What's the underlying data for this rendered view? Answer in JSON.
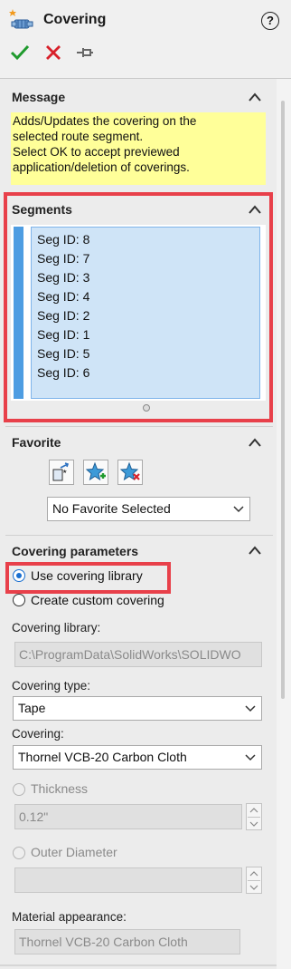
{
  "header": {
    "title": "Covering",
    "help_label": "?"
  },
  "actions": [
    "ok-checkmark",
    "cancel-x",
    "pushpin"
  ],
  "message": {
    "title": "Message",
    "lines": [
      "Adds/Updates the covering on the",
      "selected route segment.",
      "Select OK to accept previewed",
      "application/deletion of coverings."
    ]
  },
  "segments": {
    "title": "Segments",
    "items": [
      "Seg ID: 8",
      "Seg ID: 7",
      "Seg ID: 3",
      "Seg ID: 4",
      "Seg ID: 2",
      "Seg ID: 1",
      "Seg ID: 5",
      "Seg ID: 6"
    ]
  },
  "favorite": {
    "title": "Favorite",
    "selected": "No Favorite Selected"
  },
  "covering_parameters": {
    "title": "Covering parameters",
    "option_library": "Use covering library",
    "option_custom": "Create custom covering",
    "library_label": "Covering library:",
    "library_path": "C:\\ProgramData\\SolidWorks\\SOLIDWO",
    "type_label": "Covering type:",
    "type_value": "Tape",
    "covering_label": "Covering:",
    "covering_value": "Thornel VCB-20 Carbon Cloth",
    "thickness_label": "Thickness",
    "thickness_value": "0.12\"",
    "outer_diameter_label": "Outer Diameter",
    "outer_diameter_value": "",
    "material_label": "Material appearance:",
    "material_value": "Thornel VCB-20 Carbon Cloth"
  },
  "colors": {
    "highlight_border": "#e8404a",
    "message_bg": "#ffff99",
    "list_bg": "#cfe4f7",
    "accent": "#4e9de2"
  }
}
